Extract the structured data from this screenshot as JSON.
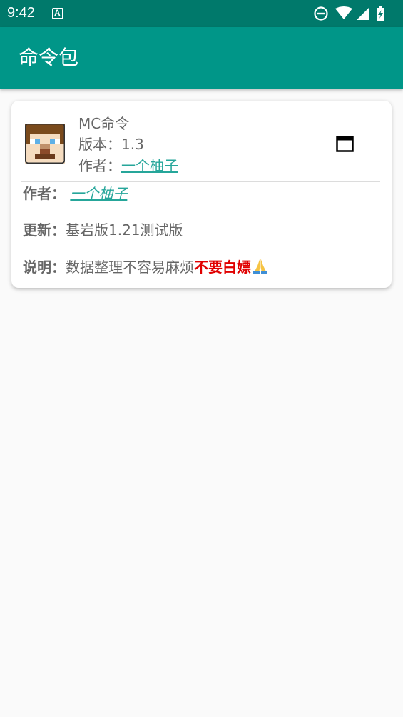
{
  "status_bar": {
    "time": "9:42",
    "icons": [
      "notification-a-icon",
      "dnd-icon",
      "wifi-icon",
      "signal-icon",
      "battery-charging-icon"
    ]
  },
  "app_bar": {
    "title": "命令包"
  },
  "card": {
    "pack_name": "MC命令",
    "version_label": "版本：",
    "version_value": "1.3",
    "author_label": "作者：",
    "author_value": "一个柚子",
    "icons": [
      "avatar-icon",
      "window-icon"
    ],
    "details": {
      "author_label": "作者：",
      "author_value": "一个柚子",
      "update_label": "更新：",
      "update_value": "基岩版1.21测试版",
      "desc_label": "说明：",
      "desc_value": "数据整理不容易麻烦",
      "desc_highlight": "不要白嫖",
      "desc_emoji_icon": "pray-icon"
    }
  },
  "colors": {
    "status_bar": "#00796b",
    "app_bar": "#009688",
    "link": "#26a69a",
    "highlight": "#e00000",
    "text": "#666666"
  }
}
